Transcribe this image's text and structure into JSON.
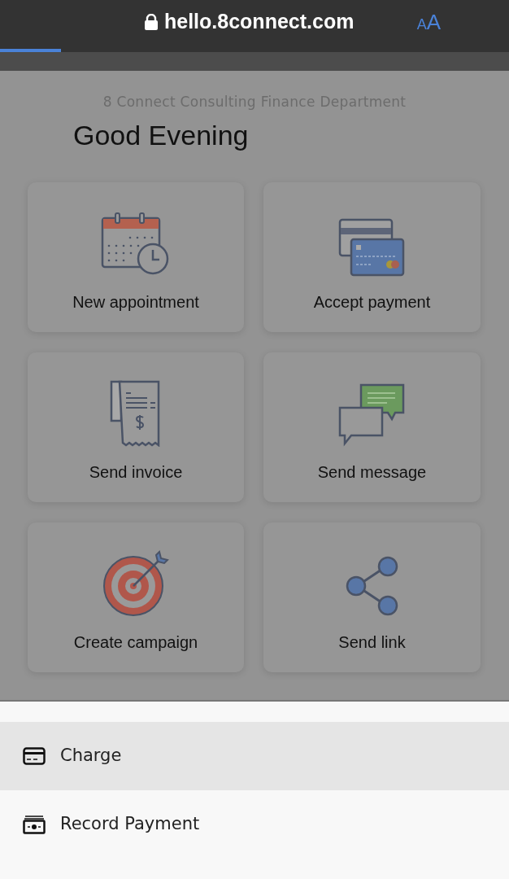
{
  "browser": {
    "url": "hello.8connect.com",
    "text_size_button": "AA",
    "load_progress": {
      "level": 0.12
    }
  },
  "page": {
    "company": "8 Connect Consulting Finance Department",
    "greeting": "Good Evening"
  },
  "actions": [
    {
      "label": "New appointment"
    },
    {
      "label": "Accept payment"
    },
    {
      "label": "Send invoice"
    },
    {
      "label": "Send message"
    },
    {
      "label": "Create campaign"
    },
    {
      "label": "Send link"
    }
  ],
  "sheet": {
    "items": [
      {
        "label": "Charge",
        "selected": true
      },
      {
        "label": "Record Payment",
        "selected": false
      }
    ]
  }
}
